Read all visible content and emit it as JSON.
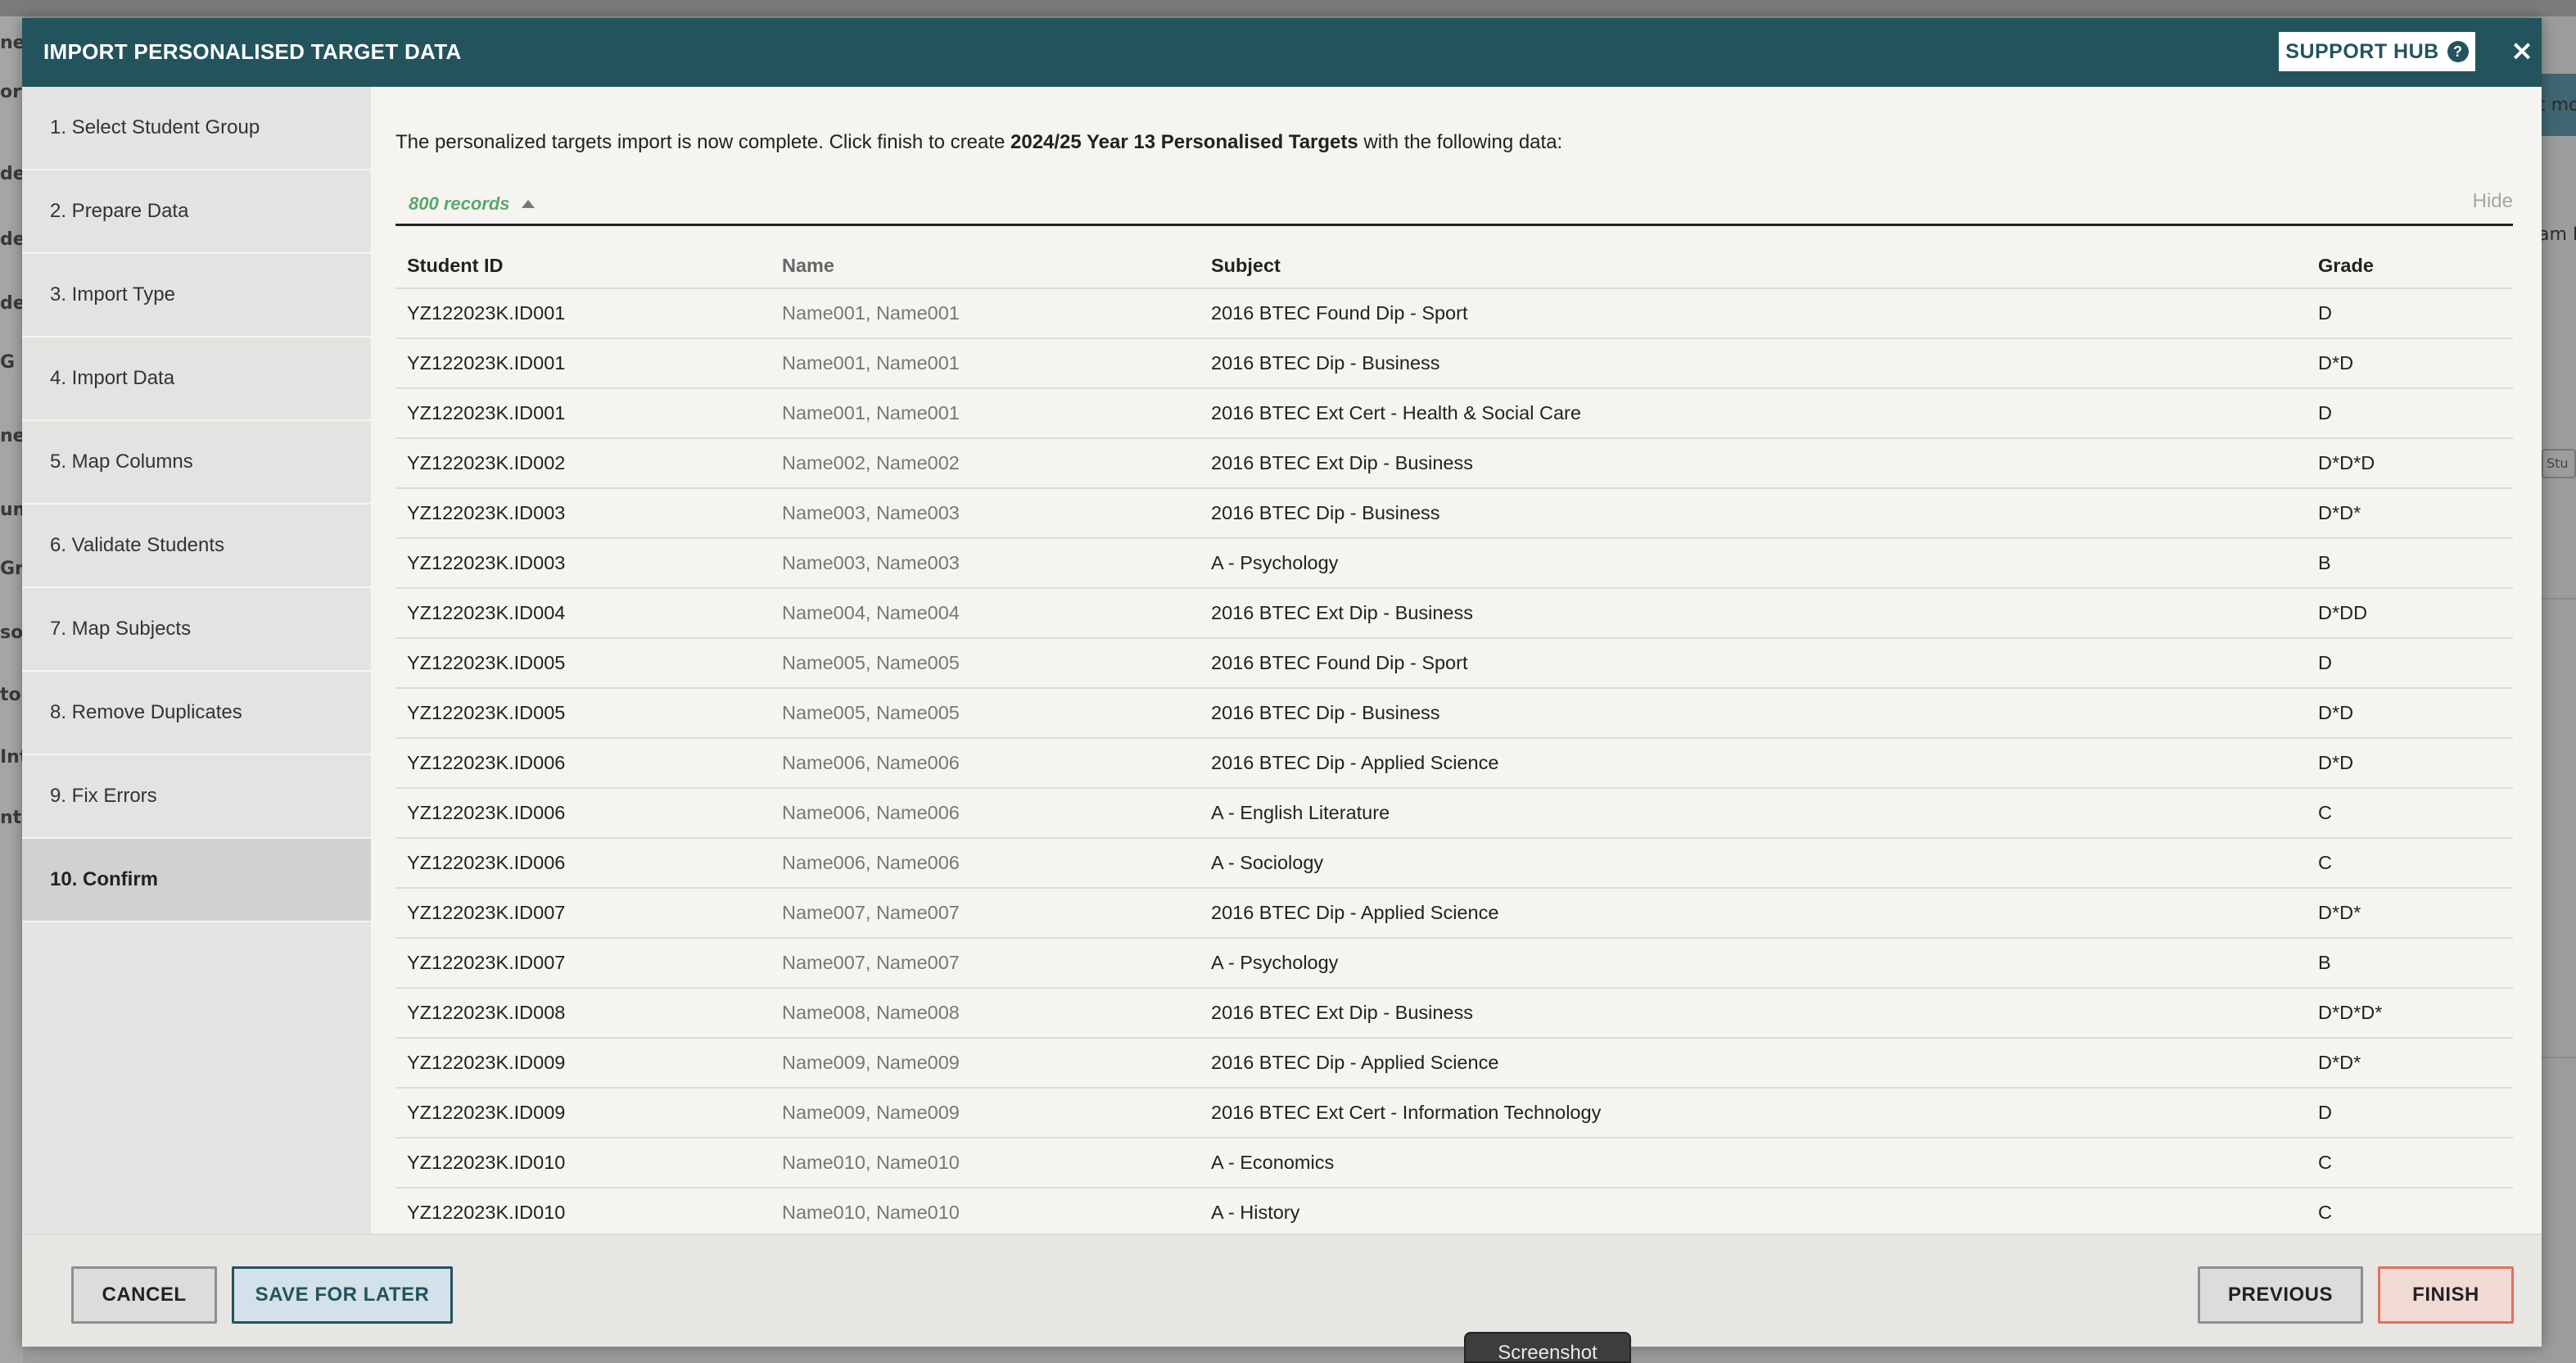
{
  "background": {
    "left_fragments": [
      "ne",
      "ort",
      "de",
      "de",
      "des",
      "G R",
      "ne",
      "um",
      "Gr",
      "son",
      "tor",
      "Int",
      "nt V"
    ],
    "right_fragments": [
      "t mo",
      "am R"
    ],
    "right_chip": "Stu"
  },
  "modal": {
    "title": "IMPORT PERSONALISED TARGET DATA",
    "support_label": "SUPPORT HUB",
    "help_glyph": "?",
    "close_glyph": "×"
  },
  "steps": [
    {
      "label": "1. Select Student Group"
    },
    {
      "label": "2. Prepare Data"
    },
    {
      "label": "3. Import Type"
    },
    {
      "label": "4. Import Data"
    },
    {
      "label": "5. Map Columns"
    },
    {
      "label": "6. Validate Students"
    },
    {
      "label": "7. Map Subjects"
    },
    {
      "label": "8. Remove Duplicates"
    },
    {
      "label": "9. Fix Errors"
    },
    {
      "label": "10. Confirm",
      "active": true
    }
  ],
  "intro": {
    "before": "The personalized targets import is now complete. Click finish to create ",
    "target_name": "2024/25 Year 13 Personalised Targets",
    "after": " with the following data:"
  },
  "records": {
    "count_label": "800 records",
    "hide_label": "Hide"
  },
  "table": {
    "headers": [
      "Student ID",
      "Name",
      "Subject",
      "Grade"
    ],
    "rows": [
      [
        "YZ122023K.ID001",
        "Name001, Name001",
        "2016 BTEC Found Dip - Sport",
        "D"
      ],
      [
        "YZ122023K.ID001",
        "Name001, Name001",
        "2016 BTEC Dip - Business",
        "D*D"
      ],
      [
        "YZ122023K.ID001",
        "Name001, Name001",
        "2016 BTEC Ext Cert - Health & Social Care",
        "D"
      ],
      [
        "YZ122023K.ID002",
        "Name002, Name002",
        "2016 BTEC Ext Dip - Business",
        "D*D*D"
      ],
      [
        "YZ122023K.ID003",
        "Name003, Name003",
        "2016 BTEC Dip - Business",
        "D*D*"
      ],
      [
        "YZ122023K.ID003",
        "Name003, Name003",
        "A - Psychology",
        "B"
      ],
      [
        "YZ122023K.ID004",
        "Name004, Name004",
        "2016 BTEC Ext Dip - Business",
        "D*DD"
      ],
      [
        "YZ122023K.ID005",
        "Name005, Name005",
        "2016 BTEC Found Dip - Sport",
        "D"
      ],
      [
        "YZ122023K.ID005",
        "Name005, Name005",
        "2016 BTEC Dip - Business",
        "D*D"
      ],
      [
        "YZ122023K.ID006",
        "Name006, Name006",
        "2016 BTEC Dip - Applied Science",
        "D*D"
      ],
      [
        "YZ122023K.ID006",
        "Name006, Name006",
        "A - English Literature",
        "C"
      ],
      [
        "YZ122023K.ID006",
        "Name006, Name006",
        "A - Sociology",
        "C"
      ],
      [
        "YZ122023K.ID007",
        "Name007, Name007",
        "2016 BTEC Dip - Applied Science",
        "D*D*"
      ],
      [
        "YZ122023K.ID007",
        "Name007, Name007",
        "A - Psychology",
        "B"
      ],
      [
        "YZ122023K.ID008",
        "Name008, Name008",
        "2016 BTEC Ext Dip - Business",
        "D*D*D*"
      ],
      [
        "YZ122023K.ID009",
        "Name009, Name009",
        "2016 BTEC Dip - Applied Science",
        "D*D*"
      ],
      [
        "YZ122023K.ID009",
        "Name009, Name009",
        "2016 BTEC Ext Cert - Information Technology",
        "D"
      ],
      [
        "YZ122023K.ID010",
        "Name010, Name010",
        "A - Economics",
        "C"
      ],
      [
        "YZ122023K.ID010",
        "Name010, Name010",
        "A - History",
        "C"
      ]
    ]
  },
  "footer": {
    "cancel_label": "CANCEL",
    "save_label": "SAVE FOR LATER",
    "previous_label": "PREVIOUS",
    "finish_label": "FINISH"
  },
  "tooltip": {
    "label": "Screenshot"
  },
  "colors": {
    "header_teal": "#23545d",
    "records_green": "#5aa86a",
    "finish_border": "#e0715b"
  }
}
